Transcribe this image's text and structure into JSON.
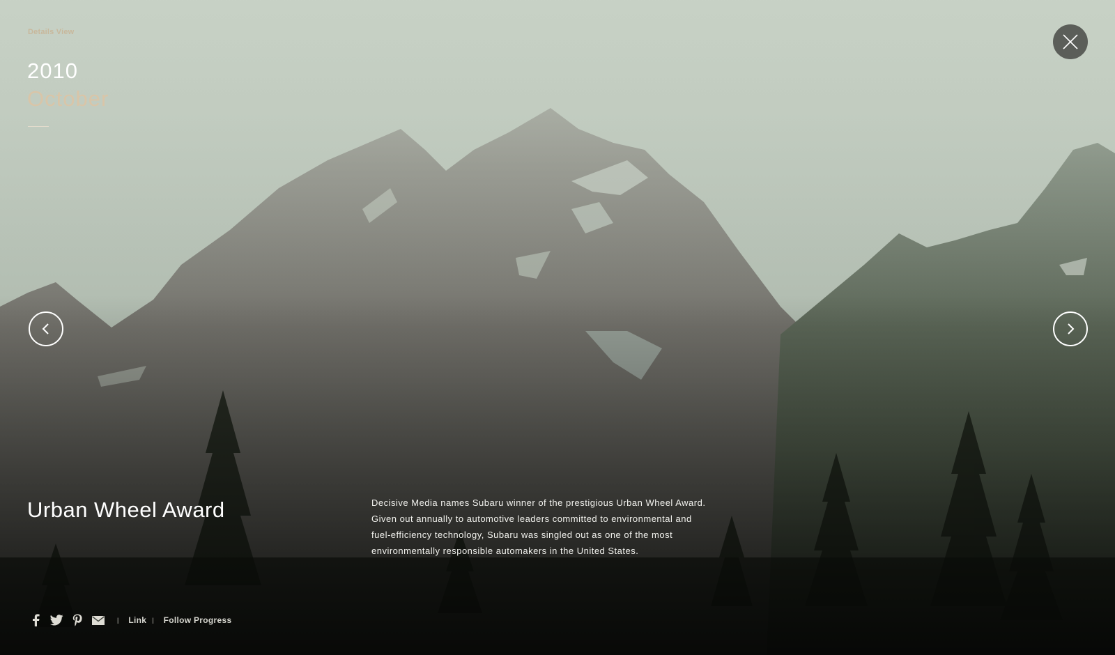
{
  "header": {
    "view_label": "Details View",
    "year": "2010",
    "month": "October"
  },
  "award": {
    "title": "Urban Wheel Award",
    "description_lines": [
      "Decisive Media names Subaru winner of the prestigious Urban Wheel Award.",
      "Given out annually to automotive leaders committed to environmental and",
      "fuel-efficiency technology, Subaru was singled out as one of the most",
      "environmentally responsible automakers in the United States."
    ]
  },
  "share": {
    "icons": [
      "facebook-icon",
      "twitter-icon",
      "pinterest-icon",
      "email-icon"
    ],
    "separator": "|",
    "link_label": "Link",
    "follow_label": "Follow Progress"
  },
  "controls": {
    "close_icon": "close-icon",
    "prev_icon": "chevron-left-icon",
    "next_icon": "chevron-right-icon"
  },
  "colors": {
    "accent_beige": "#d9c5a8",
    "text_white": "#ffffff",
    "close_bg": "#5b5e59"
  }
}
